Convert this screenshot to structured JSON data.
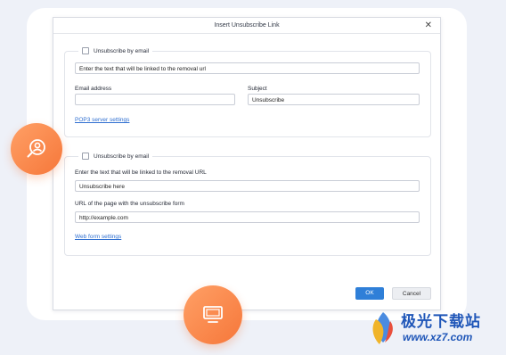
{
  "dialog": {
    "title": "Insert Unsubscribe Link",
    "close_glyph": "✕"
  },
  "section_email": {
    "checkbox_label": "Unsubscribe by email",
    "link_text_value": "Enter the text that will be linked to the removal url",
    "email_label": "Email address",
    "email_value": "",
    "subject_label": "Subject",
    "subject_value": "Unsubscribe",
    "server_link": "POP3 server settings"
  },
  "section_web": {
    "checkbox_label": "Unsubscribe by email",
    "link_text_label": "Enter the text that will be linked to the removal URL",
    "link_text_value": "Unsubscribe here",
    "url_label": "URL of the page with the unsubscribe form",
    "url_value": "http://example.com",
    "webform_link": "Web form settings"
  },
  "buttons": {
    "ok": "OK",
    "cancel": "Cancel"
  },
  "watermark": {
    "title": "极光下载站",
    "url": "www.xz7.com"
  },
  "icons": {
    "left_circle": "user-search-icon",
    "bottom_circle": "monitor-icon",
    "watermark_logo": "aurora-logo-icon"
  },
  "colors": {
    "accent_orange": "#f6773a",
    "ok_blue": "#2f7fd8",
    "link_blue": "#2f6fd0",
    "watermark_blue": "#1f56b8"
  }
}
